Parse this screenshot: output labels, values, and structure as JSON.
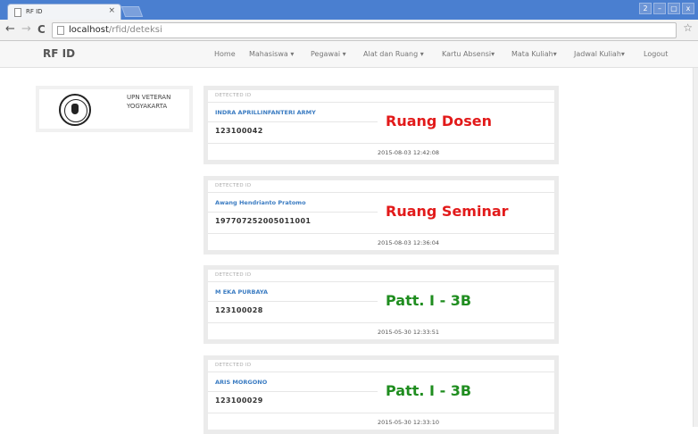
{
  "browser": {
    "tab_title": "RF ID",
    "tab_close": "×",
    "url_host": "localhost",
    "url_path": "/rfid/deteksi",
    "window_controls": [
      "2",
      "–",
      "▢",
      "x"
    ]
  },
  "navbar": {
    "brand": "RF ID",
    "items": [
      {
        "label": "Home"
      },
      {
        "label": "Mahasiswa ▾"
      },
      {
        "label": "Pegawai ▾"
      },
      {
        "label": "Alat dan Ruang ▾"
      },
      {
        "label": "Kartu Absensi▾"
      },
      {
        "label": "Mata Kuliah▾"
      },
      {
        "label": "Jadwal Kuliah▾"
      },
      {
        "label": "Logout"
      }
    ]
  },
  "sidebar": {
    "line1": "UPN VETERAN",
    "line2": "YOGYAKARTA"
  },
  "cards": [
    {
      "heading": "DETECTED ID",
      "name": "INDRA APRILLINFANTERI ARMY",
      "id_number": "123100042",
      "room": "Ruang Dosen",
      "room_color": "#e21a1a",
      "timestamp": "2015-08-03 12:42:08"
    },
    {
      "heading": "DETECTED ID",
      "name": "Awang Hendrianto Pratomo",
      "id_number": "197707252005011001",
      "room": "Ruang Seminar",
      "room_color": "#e21a1a",
      "timestamp": "2015-08-03 12:36:04"
    },
    {
      "heading": "DETECTED ID",
      "name": "M EKA PURBAYA",
      "id_number": "123100028",
      "room": "Patt. I - 3B",
      "room_color": "#1f8d1f",
      "timestamp": "2015-05-30 12:33:51"
    },
    {
      "heading": "DETECTED ID",
      "name": "ARIS MORGONO",
      "id_number": "123100029",
      "room": "Patt. I - 3B",
      "room_color": "#1f8d1f",
      "timestamp": "2015-05-30 12:33:10"
    }
  ]
}
